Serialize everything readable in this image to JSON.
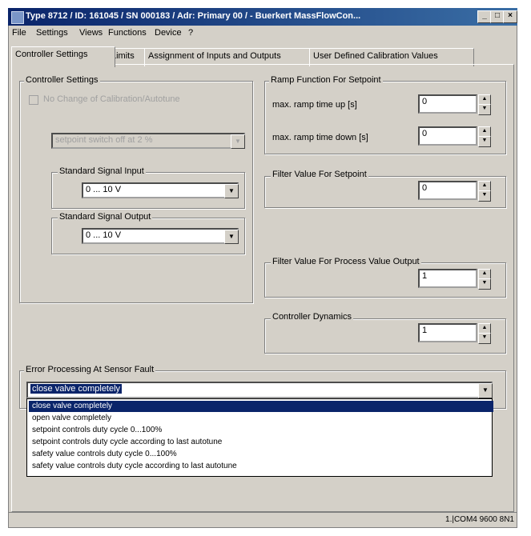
{
  "window": {
    "title": "Type 8712 / ID: 161045 / SN 000183 / Adr: Primary 00 / - Buerkert MassFlowCon..."
  },
  "title_buttons": {
    "minimize": "_",
    "maximize": "□",
    "close": "×"
  },
  "menu": [
    "File",
    "Settings",
    "Views",
    "Functions",
    "Device",
    "?"
  ],
  "tabs": [
    {
      "label": "Controller Settings",
      "active": true
    },
    {
      "label": "Limits",
      "active": false
    },
    {
      "label": "Assignment of Inputs and Outputs",
      "active": false
    },
    {
      "label": "User Defined Calibration Values",
      "active": false
    }
  ],
  "controller_settings": {
    "group_label": "Controller Settings",
    "checkbox_label": "No Change of Calibration/Autotune",
    "disabled_select_value": "setpoint switch off at 2 %"
  },
  "signal_input": {
    "label": "Standard Signal Input",
    "value": "0 ... 10 V"
  },
  "signal_output": {
    "label": "Standard Signal Output",
    "value": "0 ... 10 V"
  },
  "ramp": {
    "group_label": "Ramp Function For Setpoint",
    "up_label": "max. ramp time up [s]",
    "up_value": "0",
    "down_label": "max. ramp time down [s]",
    "down_value": "0"
  },
  "filter_setpoint": {
    "label": "Filter Value For Setpoint",
    "value": "0"
  },
  "filter_process": {
    "label": "Filter Value For Process Value Output",
    "value": "1"
  },
  "dynamics": {
    "label": "Controller Dynamics",
    "value": "1"
  },
  "error_processing": {
    "label": "Error Processing At Sensor Fault",
    "selected": "close valve completely",
    "options": [
      "close valve completely",
      "open valve completely",
      "setpoint controls duty cycle 0...100%",
      "setpoint controls duty cycle according to last autotune",
      "safety value controls duty cycle 0...100%",
      "safety value controls duty cycle according to last autotune"
    ]
  },
  "status_bar": {
    "connection": "1.|COM4 9600 8N1"
  },
  "colors": {
    "title_start": "#0a246a",
    "title_end": "#3a6ea5",
    "selection": "#0a246a",
    "face": "#d4d0c8"
  }
}
